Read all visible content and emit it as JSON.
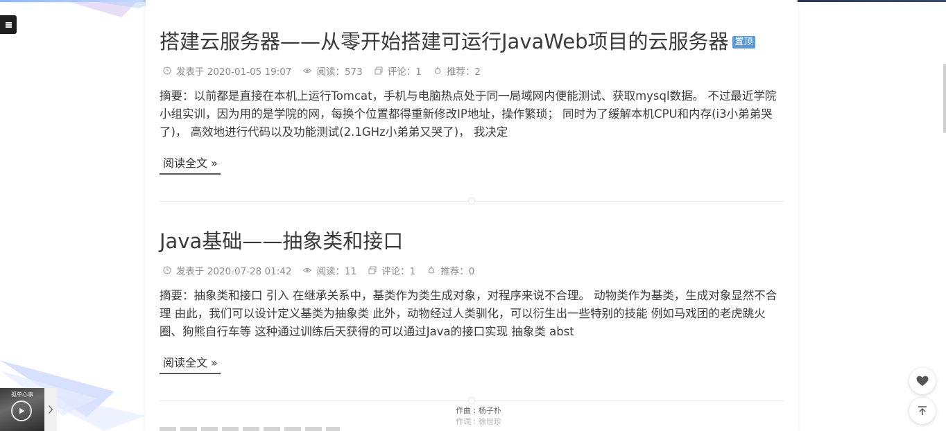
{
  "colors": {
    "pin_badge_bg": "#5b9bd5",
    "title_text": "#3a3a3a",
    "meta_text": "#8a8a8a",
    "menu_button_bg": "#1f1f1f"
  },
  "sidebar": {
    "menu_icon": "hamburger-icon"
  },
  "posts": [
    {
      "title": "搭建云服务器——从零开始搭建可运行JavaWeb项目的云服务器",
      "badge": "置顶",
      "meta": {
        "published": "发表于 2020-01-05 19:07",
        "reads": "阅读：573",
        "comments": "评论：1",
        "recommends": "推荐：2"
      },
      "summary": "摘要：以前都是直接在本机上运行Tomcat，手机与电脑热点处于同一局域网内便能测试、获取mysql数据。 不过最近学院小组实训，因为用的是学院的网，每换个位置都得重新修改IP地址，操作繁琐； 同时为了缓解本机CPU和内存(i3小弟弟哭了)， 高效地进行代码以及功能测试(2.1GHz小弟弟又哭了)， 我决定",
      "read_more": "阅读全文 »"
    },
    {
      "title": "Java基础——抽象类和接口",
      "meta": {
        "published": "发表于 2020-07-28 01:42",
        "reads": "阅读：11",
        "comments": "评论：1",
        "recommends": "推荐：0"
      },
      "summary": "摘要：抽象类和接口 引入 在继承关系中，基类作为类生成对象，对程序来说不合理。 动物类作为基类，生成对象显然不合理 由此，我们可以设计定义基类为抽象类 此外，动物经过人类驯化，可以衍生出一些特别的技能 例如马戏团的老虎跳火圈、狗熊自行车等 这种通过训练后天获得的可以通过Java的接口实现 抽象类 abst",
      "read_more": "阅读全文 »"
    }
  ],
  "lyrics": {
    "composer": "作曲 : 杨子朴",
    "lyricist": "作词 : 徐世珍"
  },
  "player": {
    "cover_text": "孤单心事",
    "play_icon": "play-icon",
    "expand_icon": "chevron-right-icon"
  },
  "floating": {
    "like_icon": "heart-icon",
    "top_icon": "back-to-top-icon"
  }
}
